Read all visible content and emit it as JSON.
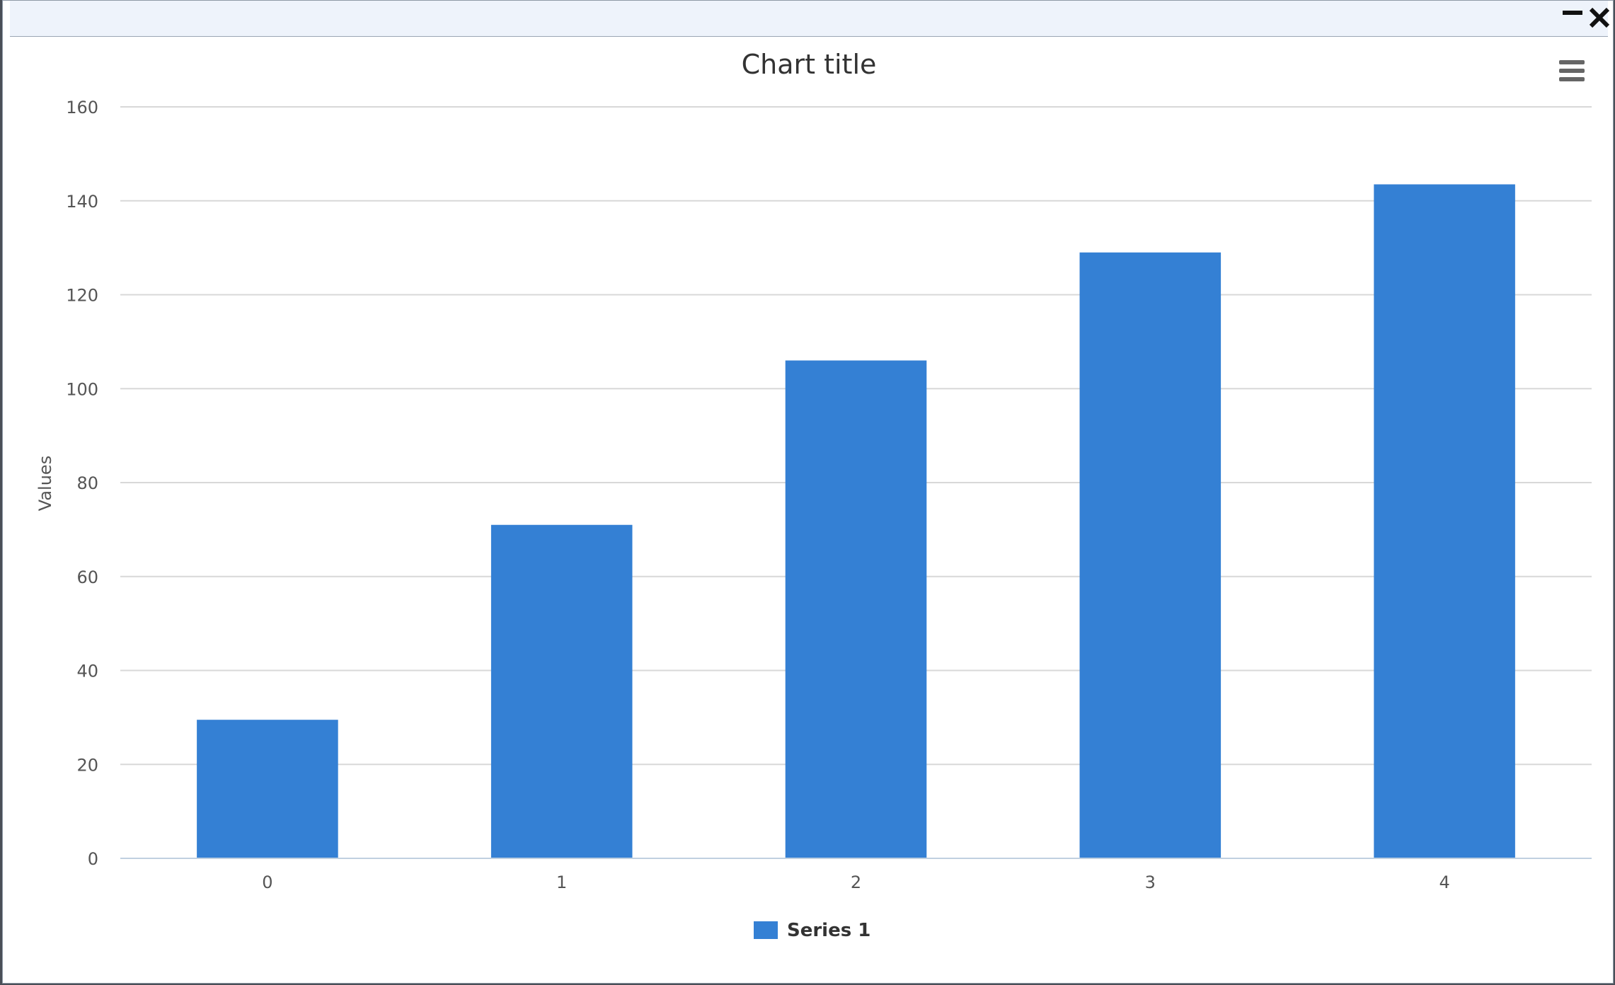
{
  "window": {
    "minimize_icon": "minimize-icon",
    "close_icon": "close-icon",
    "menu_icon": "hamburger-menu-icon"
  },
  "chart_data": {
    "type": "bar",
    "title": "Chart title",
    "xlabel": "",
    "ylabel": "Values",
    "categories": [
      "0",
      "1",
      "2",
      "3",
      "4"
    ],
    "series": [
      {
        "name": "Series 1",
        "color": "#3480d4",
        "values": [
          29.5,
          71,
          106,
          129,
          143.5
        ]
      }
    ],
    "ylim": [
      0,
      160
    ],
    "yticks": [
      "0",
      "20",
      "40",
      "60",
      "80",
      "100",
      "120",
      "140",
      "160"
    ],
    "grid": true,
    "legend_position": "bottom-center"
  }
}
